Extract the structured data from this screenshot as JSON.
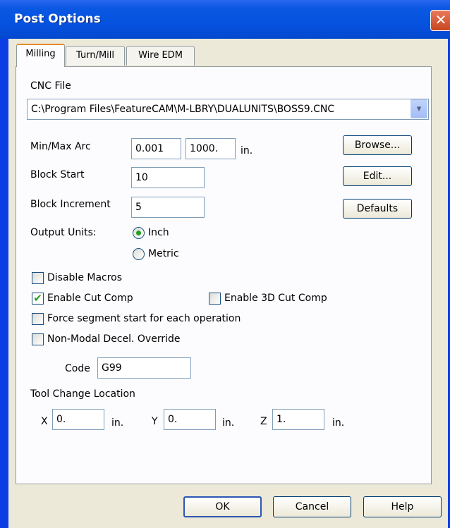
{
  "window": {
    "title": "Post Options",
    "close_glyph": "✕"
  },
  "tabs": [
    {
      "label": "Milling",
      "active": true
    },
    {
      "label": "Turn/Mill",
      "active": false
    },
    {
      "label": "Wire EDM",
      "active": false
    }
  ],
  "cnc_file": {
    "label": "CNC File",
    "value": "C:\\Program Files\\FeatureCAM\\M-LBRY\\DUALUNITS\\BOSS9.CNC",
    "arrow_glyph": "▾"
  },
  "arc": {
    "label": "Min/Max Arc",
    "min": "0.001",
    "max": "1000.",
    "unit": "in."
  },
  "block_start": {
    "label": "Block Start",
    "value": "10"
  },
  "block_increment": {
    "label": "Block Increment",
    "value": "5"
  },
  "buttons": {
    "browse": "Browse...",
    "edit": "Edit...",
    "defaults": "Defaults"
  },
  "output_units": {
    "label": "Output Units:",
    "options": [
      {
        "label": "Inch",
        "selected": true
      },
      {
        "label": "Metric",
        "selected": false
      }
    ]
  },
  "checkboxes": {
    "disable_macros": {
      "label": "Disable Macros",
      "checked": false
    },
    "enable_cut_comp": {
      "label": "Enable Cut Comp",
      "checked": true
    },
    "enable_3d_cut_comp": {
      "label": "Enable 3D Cut Comp",
      "checked": false
    },
    "force_segment_start": {
      "label": "Force segment start for each operation",
      "checked": false
    },
    "non_modal_decel": {
      "label": "Non-Modal Decel. Override",
      "checked": false
    }
  },
  "check_glyph": "✔",
  "code": {
    "label": "Code",
    "value": "G99"
  },
  "tool_change": {
    "label": "Tool Change Location",
    "x": {
      "label": "X",
      "value": "0.",
      "unit": "in."
    },
    "y": {
      "label": "Y",
      "value": "0.",
      "unit": "in."
    },
    "z": {
      "label": "Z",
      "value": "1.",
      "unit": "in."
    }
  },
  "footer": {
    "ok": "OK",
    "cancel": "Cancel",
    "help": "Help"
  }
}
